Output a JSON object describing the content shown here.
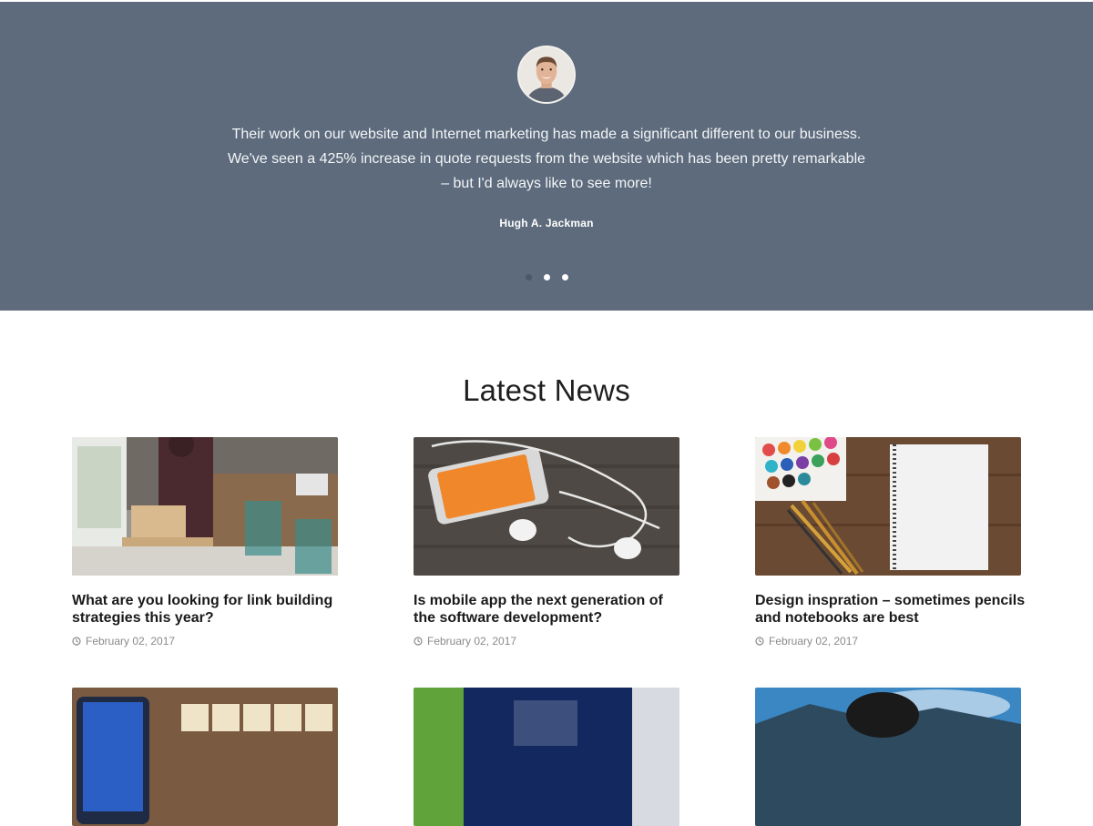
{
  "testimonial": {
    "quote_line1": "Their work on our website and Internet marketing has made a significant different to our business.",
    "quote_line2": "We've seen a 425% increase in quote requests from the website which has been pretty remarkable",
    "quote_line3": "– but I'd always like to see more!",
    "author": "Hugh A. Jackman",
    "slides": 3,
    "active_slide": 1,
    "background_color": "#5d6b7c"
  },
  "news": {
    "title": "Latest News",
    "posts": [
      {
        "title": "What are you looking for link building strategies this year?",
        "date": "February 02, 2017",
        "image": "office-packages-photo"
      },
      {
        "title": "Is mobile app the next generation of the software development?",
        "date": "February 02, 2017",
        "image": "phone-earphones-photo"
      },
      {
        "title": "Design inspration – sometimes pencils and notebooks are best",
        "date": "February 02, 2017",
        "image": "paint-notebook-photo"
      },
      {
        "image": "social-tiles-photo"
      },
      {
        "image": "monitor-plant-photo"
      },
      {
        "image": "sky-mountains-photo"
      }
    ]
  }
}
